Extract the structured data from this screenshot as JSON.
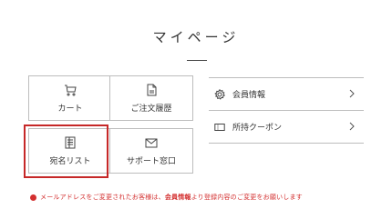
{
  "page": {
    "title": "マイページ"
  },
  "tiles": [
    {
      "label": "カート",
      "icon": "cart-icon"
    },
    {
      "label": "ご注文履歴",
      "icon": "document-icon"
    },
    {
      "label": "宛名リスト",
      "icon": "address-list-icon"
    },
    {
      "label": "サポート窓口",
      "icon": "mail-icon"
    }
  ],
  "menu": [
    {
      "label": "会員情報",
      "icon": "gear-icon"
    },
    {
      "label": "所持クーポン",
      "icon": "coupon-icon"
    }
  ],
  "notice": {
    "prefix": "メールアドレスをご変更されたお客様は、",
    "link": "会員情報",
    "suffix": "より登録内容のご変更をお願いします"
  },
  "colors": {
    "highlight": "#c62828",
    "notice": "#d32f2f",
    "border": "#bdbdbd",
    "text": "#333333"
  }
}
